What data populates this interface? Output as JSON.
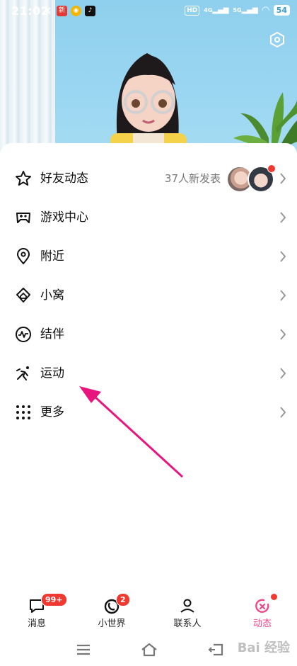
{
  "status_bar": {
    "time": "21:02",
    "apps": [
      "blocked-notification-icon",
      "news-app-icon",
      "weibo-icon",
      "tiktok-icon"
    ],
    "network": [
      "HD",
      "4G",
      "5G"
    ],
    "wifi": "wifi-icon",
    "battery": "54"
  },
  "header": {
    "action_icon": "hexagon-settings-icon"
  },
  "menu": [
    {
      "icon": "star-icon",
      "label": "好友动态",
      "subtitle": "37人新发表",
      "has_avatars": true,
      "has_red_dot": true
    },
    {
      "icon": "gamepad-icon",
      "label": "游戏中心"
    },
    {
      "icon": "location-pin-icon",
      "label": "附近"
    },
    {
      "icon": "home-nest-icon",
      "label": "小窝"
    },
    {
      "icon": "pulse-circle-icon",
      "label": "结伴"
    },
    {
      "icon": "running-icon",
      "label": "运动"
    },
    {
      "icon": "grid-dots-icon",
      "label": "更多"
    }
  ],
  "tabs": [
    {
      "icon": "message-icon",
      "label": "消息",
      "badge": "99+"
    },
    {
      "icon": "small-world-icon",
      "label": "小世界",
      "badge": "2"
    },
    {
      "icon": "contacts-icon",
      "label": "联系人"
    },
    {
      "icon": "activity-icon",
      "label": "动态",
      "active": true,
      "dot": true
    }
  ],
  "colors": {
    "accent_pink": "#f0478b",
    "badge_red": "#f2392f",
    "annotation_arrow": "#e8157f"
  },
  "watermark": "Bai 经验"
}
